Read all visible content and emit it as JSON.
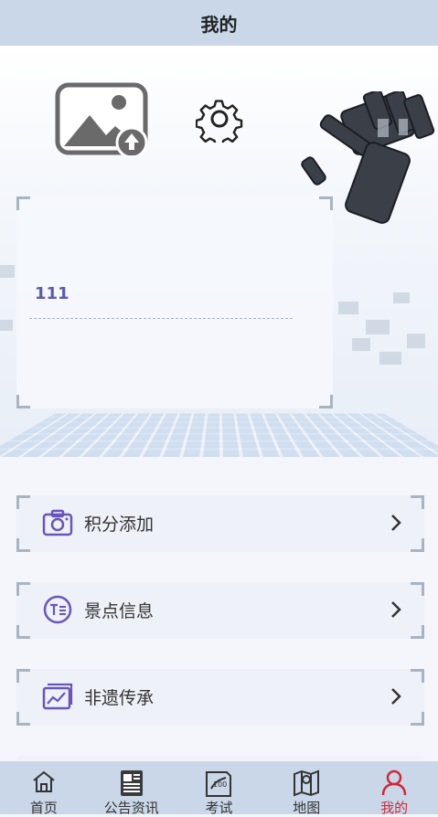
{
  "header": {
    "title": "我的"
  },
  "profile": {
    "username": "111"
  },
  "menu": {
    "items": [
      {
        "label": "积分添加",
        "icon": "camera-icon"
      },
      {
        "label": "景点信息",
        "icon": "text-badge-icon"
      },
      {
        "label": "非遗传承",
        "icon": "picture-frame-icon"
      }
    ]
  },
  "tabbar": {
    "items": [
      {
        "label": "首页",
        "icon": "home-icon"
      },
      {
        "label": "公告资讯",
        "icon": "document-icon"
      },
      {
        "label": "考试",
        "icon": "exam-icon"
      },
      {
        "label": "地图",
        "icon": "map-icon"
      },
      {
        "label": "我的",
        "icon": "user-icon",
        "active": true
      }
    ]
  },
  "colors": {
    "header_bg": "#c9d7e8",
    "accent": "#5b5bb0",
    "active_tab": "#d0283a"
  }
}
